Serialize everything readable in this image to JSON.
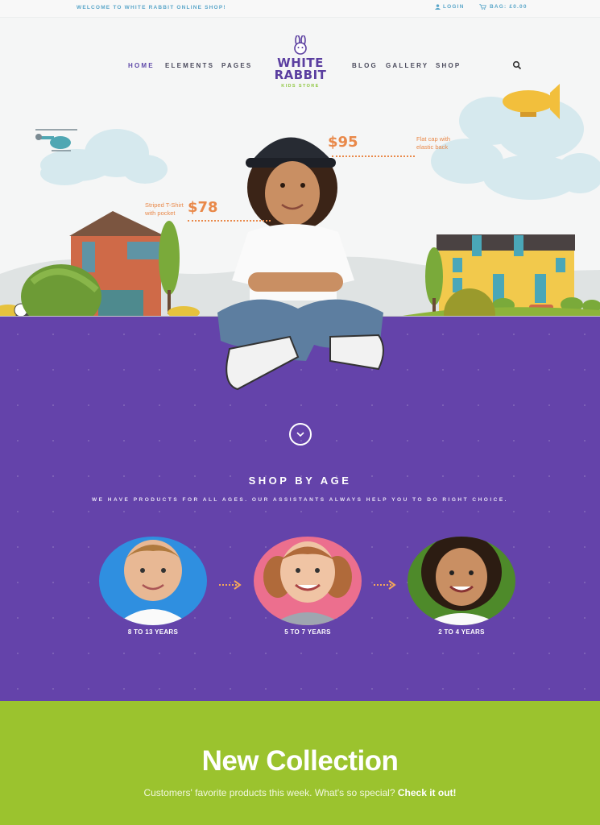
{
  "topbar": {
    "welcome": "WELCOME TO WHITE RABBIT ONLINE SHOP!",
    "login": "LOGIN",
    "bag": "BAG: £0.00"
  },
  "nav": {
    "left": [
      "HOME",
      "ELEMENTS",
      "PAGES"
    ],
    "right": [
      "BLOG",
      "GALLERY",
      "SHOP"
    ]
  },
  "logo": {
    "line1": "WHITE",
    "line2": "RABBIT",
    "tagline": "KIDS STORE"
  },
  "hero": {
    "tshirt_note_1": "Striped T-Shirt",
    "tshirt_note_2": "with pocket",
    "tshirt_price": "$78",
    "cap_price": "$95",
    "cap_note_1": "Flat cap with",
    "cap_note_2": "elastic back"
  },
  "shop_by_age": {
    "title": "SHOP BY AGE",
    "subtitle": "WE HAVE PRODUCTS FOR ALL AGES. OUR ASSISTANTS ALWAYS HELP YOU TO DO RIGHT CHOICE.",
    "groups": [
      {
        "label": "8 TO 13 YEARS",
        "color": "#2f8fe0"
      },
      {
        "label": "5 TO 7 YEARS",
        "color": "#ec6f8e"
      },
      {
        "label": "2 TO 4 YEARS",
        "color": "#4e8a2a"
      }
    ]
  },
  "collection": {
    "title": "New Collection",
    "subtitle": "Customers' favorite products this week. What's so special?",
    "link": "Check it out!"
  },
  "colors": {
    "purple": "#6443aa",
    "green": "#9bc32e",
    "accent_orange": "#e9894a",
    "topbar_text": "#5aa6c9"
  }
}
